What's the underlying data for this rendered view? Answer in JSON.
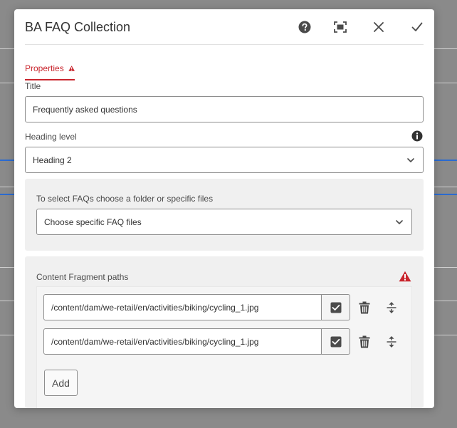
{
  "dialog": {
    "title": "BA FAQ Collection",
    "header_icons": [
      "help-icon",
      "fullscreen-icon",
      "close-icon",
      "done-check-icon"
    ]
  },
  "tabs": [
    {
      "label": "Properties",
      "icon": "alert-icon",
      "active": true
    }
  ],
  "form": {
    "title_label": "Title",
    "title_value": "Frequently asked questions",
    "heading_label": "Heading level",
    "heading_info_icon": "info-icon",
    "heading_value": "Heading 2",
    "faq_source_label": "To select FAQs choose a folder or specific files",
    "faq_source_value": "Choose specific FAQ files",
    "paths_label": "Content Fragment paths",
    "paths_warning_icon": "alert-icon",
    "paths": [
      "/content/dam/we-retail/en/activities/biking/cycling_1.jpg",
      "/content/dam/we-retail/en/activities/biking/cycling_1.jpg"
    ],
    "add_label": "Add"
  },
  "colors": {
    "accent_red": "#c9252d",
    "text": "#323232",
    "border": "#8e8e8e",
    "panel_bg": "#f0f0f0",
    "backdrop": "#8a8a8a"
  }
}
